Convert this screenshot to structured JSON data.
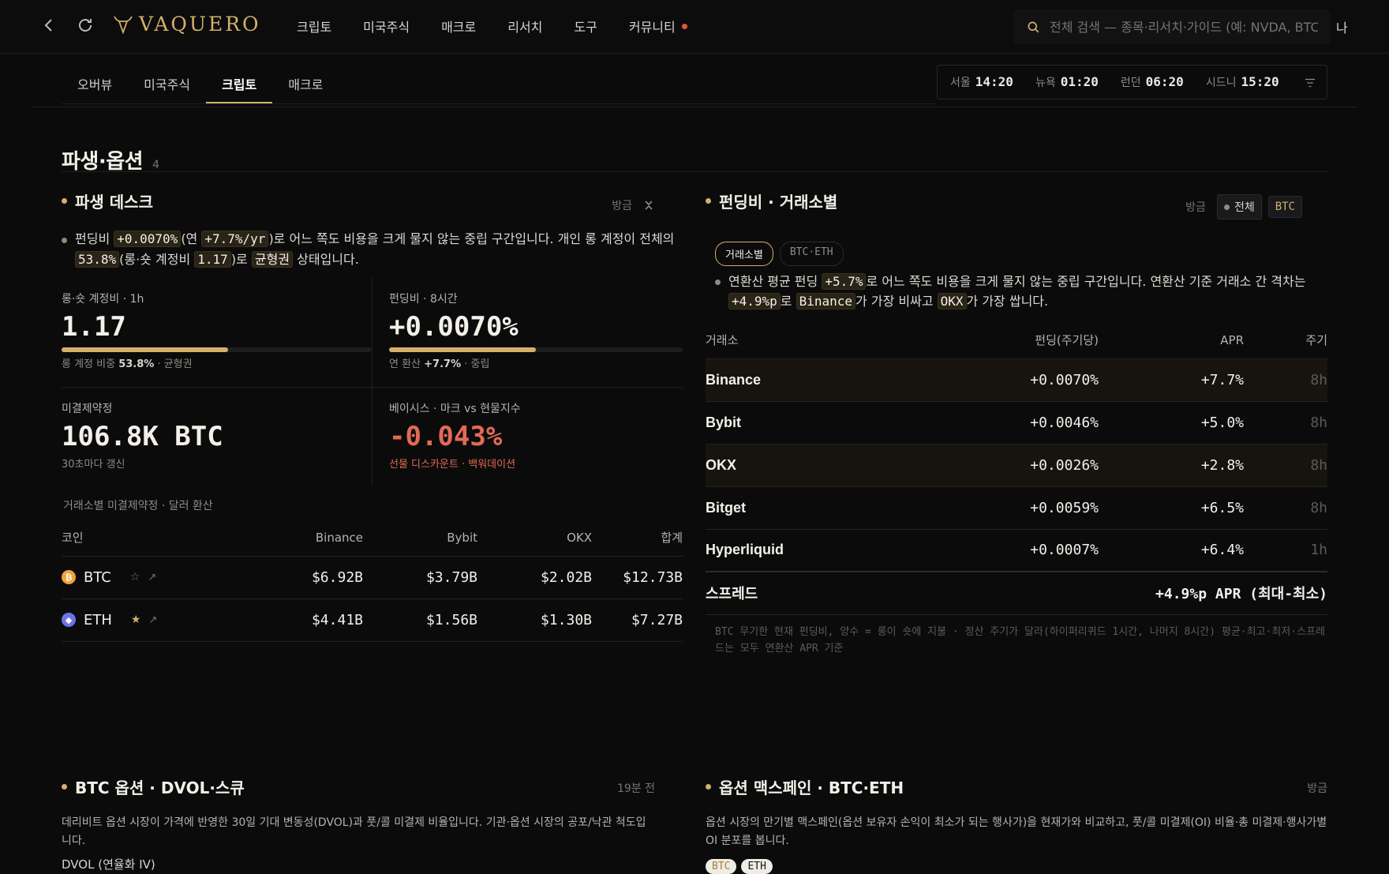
{
  "topbar": {
    "brand": "VAQUERO",
    "nav": [
      "크립토",
      "미국주식",
      "매크로",
      "리서치",
      "도구",
      "커뮤니티"
    ],
    "search_placeholder": "전체 검색 — 종목·리서치·가이드 (예: NVDA, BTC)",
    "user": "나"
  },
  "subnav": {
    "tabs": [
      "오버뷰",
      "미국주식",
      "크립토",
      "매크로"
    ],
    "active": "크립토"
  },
  "clocks": [
    {
      "city": "서울",
      "time": "14:20"
    },
    {
      "city": "뉴욕",
      "time": "01:20"
    },
    {
      "city": "런던",
      "time": "06:20"
    },
    {
      "city": "시드니",
      "time": "15:20"
    }
  ],
  "section": {
    "title": "파생·옵션",
    "count": "4"
  },
  "desk": {
    "title": "파생 데스크",
    "meta": "방금",
    "summary": {
      "p1": "펀딩비 ",
      "funding": "+0.0070%",
      "p2": "(연 ",
      "annual": "+7.7%/yr",
      "p3": ")로 어느 쪽도 비용을 크게 물지 않는 중립 구간입니다. 개인 롱 계정이 전체의 ",
      "long_pct": "53.8%",
      "p4": "(롱·숏 계정비 ",
      "ratio": "1.17",
      "p5": ")로 ",
      "state": "균형권",
      "p6": " 상태입니다."
    },
    "kpis": {
      "ls_label": "롱·숏 계정비 · 1h",
      "ls_value": "1.17",
      "ls_bar": 0.538,
      "ls_sub_pre": "롱 계정 비중 ",
      "ls_sub_val": "53.8%",
      "ls_sub_post": " · 균형권",
      "fund_label": "펀딩비 · 8시간",
      "fund_value": "+0.0070%",
      "fund_bar": 0.5,
      "fund_sub_pre": "연 환산 ",
      "fund_sub_val": "+7.7%",
      "fund_sub_post": " · 중립",
      "oi_label": "미결제약정",
      "oi_value": "106.8K BTC",
      "oi_sub": "30초마다 갱신",
      "basis_label": "베이시스 · 마크 vs 현물지수",
      "basis_value": "-0.043%",
      "basis_sub": "선물 디스카운트 · 백워데이션"
    },
    "oi_caption": "거래소별 미결제약정 · 달러 환산",
    "oi_headers": [
      "코인",
      "Binance",
      "Bybit",
      "OKX",
      "합계"
    ],
    "oi_rows": [
      {
        "coin": "BTC",
        "icon": "₿",
        "color": "#f2a33a",
        "starred": false,
        "binance": "$6.92B",
        "bybit": "$3.79B",
        "okx": "$2.02B",
        "total": "$12.73B"
      },
      {
        "coin": "ETH",
        "icon": "◆",
        "color": "#6a74e6",
        "starred": true,
        "binance": "$4.41B",
        "bybit": "$1.56B",
        "okx": "$1.30B",
        "total": "$7.27B"
      }
    ]
  },
  "funding": {
    "title": "펀딩비 · 거래소별",
    "meta": "방금",
    "chips": [
      "전체",
      "BTC"
    ],
    "pills": [
      "거래소별",
      "BTC·ETH"
    ],
    "summary": {
      "p1": "연환산 평균 펀딩 ",
      "avg": "+5.7%",
      "p2": "로 어느 쪽도 비용을 크게 물지 않는 중립 구간입니다. 연환산 기준 거래소 간 격차는 ",
      "gap": "+4.9%p",
      "p3": "로 ",
      "max": "Binance",
      "p4": "가 가장 비싸고 ",
      "min": "OKX",
      "p5": "가 가장 쌉니다."
    },
    "headers": [
      "거래소",
      "펀딩(주기당)",
      "APR",
      "주기"
    ],
    "rows": [
      {
        "ex": "Binance",
        "rate": "+0.0070%",
        "apr": "+7.7%",
        "cycle": "8h",
        "hi": true
      },
      {
        "ex": "Bybit",
        "rate": "+0.0046%",
        "apr": "+5.0%",
        "cycle": "8h",
        "hi": false
      },
      {
        "ex": "OKX",
        "rate": "+0.0026%",
        "apr": "+2.8%",
        "cycle": "8h",
        "hi": true
      },
      {
        "ex": "Bitget",
        "rate": "+0.0059%",
        "apr": "+6.5%",
        "cycle": "8h",
        "hi": false
      },
      {
        "ex": "Hyperliquid",
        "rate": "+0.0007%",
        "apr": "+6.4%",
        "cycle": "1h",
        "hi": false
      }
    ],
    "spread_label": "스프레드",
    "spread_value": "+4.9%p APR (최대-최소)",
    "note": "BTC 무기한 현재 펀딩비, 양수 = 롱이 숏에 지불 · 정산 주기가 달라(하이퍼리퀴드 1시간, 나머지 8시간) 평균·최고·최저·스프레드는 모두 연환산 APR 기준"
  },
  "options": {
    "title": "BTC 옵션 · DVOL·스큐",
    "meta": "19분 전",
    "desc": "데리비트 옵션 시장이 가격에 반영한 30일 기대 변동성(DVOL)과 풋/콜 미결제 비율입니다. 기관·옵션 시장의 공포/낙관 척도입니다.",
    "dvol_label": "DVOL (연율화 IV)"
  },
  "maxpain": {
    "title": "옵션 맥스페인 · BTC·ETH",
    "meta": "방금",
    "desc": "옵션 시장의 만기별 맥스페인(옵션 보유자 손익이 최소가 되는 행사가)을 현재가와 비교하고, 풋/콜 미결제(OI) 비율·총 미결제·행사가별 OI 분포를 봅니다.",
    "pills": [
      "BTC",
      "ETH"
    ]
  }
}
